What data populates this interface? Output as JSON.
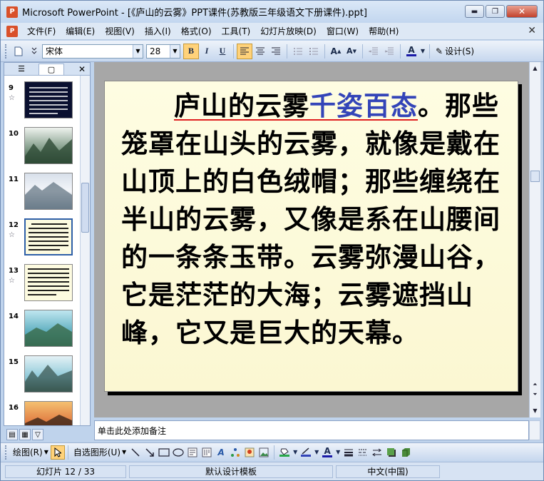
{
  "window": {
    "title": "Microsoft PowerPoint - [《庐山的云雾》PPT课件(苏教版三年级语文下册课件).ppt]",
    "app_icon": "P",
    "minimize": "▬",
    "maximize": "❐",
    "close": "✕"
  },
  "menu": {
    "items": [
      "文件(F)",
      "编辑(E)",
      "视图(V)",
      "插入(I)",
      "格式(O)",
      "工具(T)",
      "幻灯片放映(D)",
      "窗口(W)",
      "帮助(H)"
    ],
    "close": "✕"
  },
  "toolbar": {
    "font_name": "宋体",
    "font_size": "28",
    "bold": "B",
    "italic": "I",
    "underline": "U",
    "design": "设计(S)"
  },
  "thumbnails": [
    {
      "num": "9",
      "star": "☆"
    },
    {
      "num": "10",
      "star": ""
    },
    {
      "num": "11",
      "star": ""
    },
    {
      "num": "12",
      "star": "☆"
    },
    {
      "num": "13",
      "star": "☆"
    },
    {
      "num": "14",
      "star": ""
    },
    {
      "num": "15",
      "star": ""
    },
    {
      "num": "16",
      "star": ""
    }
  ],
  "slide": {
    "title_a": "庐山的云雾",
    "title_b": "千姿百态",
    "title_c": "。",
    "body": "那些笼罩在山头的云雾，就像是戴在山顶上的白色绒帽；那些缠绕在半山的云雾，又像是系在山腰间的一条条玉带。云雾弥漫山谷，它是茫茫的大海；云雾遮挡山峰，它又是巨大的天幕。"
  },
  "notes": {
    "placeholder": "单击此处添加备注"
  },
  "drawing": {
    "draw": "绘图(R)",
    "autoshapes": "自选图形(U)"
  },
  "status": {
    "slide": "幻灯片 12 / 33",
    "template": "默认设计模板",
    "language": "中文(中国)"
  },
  "colors": {
    "title_highlight": "#3344b8",
    "underline": "#e02020",
    "slide_bg": "#fefde2"
  }
}
